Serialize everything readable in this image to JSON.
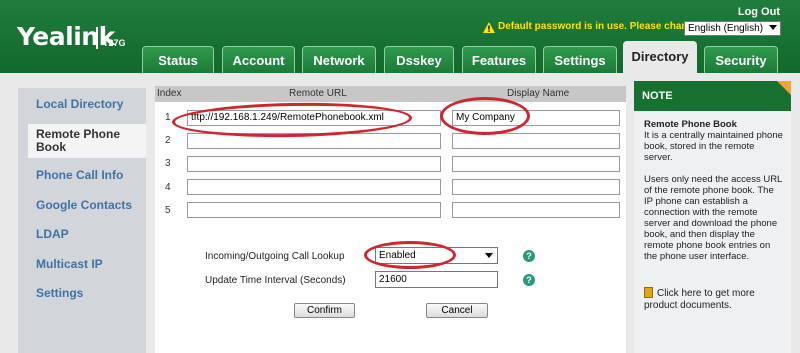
{
  "header": {
    "brand": "Yealink",
    "model": "T27G",
    "logout": "Log Out",
    "warning": "Default password is in use. Please change!",
    "language": "English (English)"
  },
  "tabs": [
    "Status",
    "Account",
    "Network",
    "Dsskey",
    "Features",
    "Settings",
    "Directory",
    "Security"
  ],
  "active_tab": "Directory",
  "sidebar": {
    "items": [
      "Local Directory",
      "Remote Phone Book",
      "Phone Call Info",
      "Google Contacts",
      "LDAP",
      "Multicast IP",
      "Settings"
    ],
    "active": "Remote Phone Book"
  },
  "table": {
    "headers": {
      "index": "Index",
      "url": "Remote URL",
      "name": "Display Name"
    },
    "rows": [
      {
        "index": "1",
        "url": "tftp://192.168.1.249/RemotePhonebook.xml",
        "name": "My Company"
      },
      {
        "index": "2",
        "url": "",
        "name": ""
      },
      {
        "index": "3",
        "url": "",
        "name": ""
      },
      {
        "index": "4",
        "url": "",
        "name": ""
      },
      {
        "index": "5",
        "url": "",
        "name": ""
      }
    ]
  },
  "form": {
    "lookup_label": "Incoming/Outgoing Call Lookup",
    "lookup_value": "Enabled",
    "interval_label": "Update Time Interval (Seconds)",
    "interval_value": "21600",
    "help": "?",
    "confirm": "Confirm",
    "cancel": "Cancel"
  },
  "note": {
    "heading": "NOTE",
    "title": "Remote Phone Book",
    "p1": "It is a centrally maintained phone book, stored in the remote server.",
    "p2": "Users only need the access URL of the remote phone book. The IP phone can establish a connection with the remote server and download the phone book, and then display the remote phone book entries on the phone user interface.",
    "link": "Click here to get more product documents."
  },
  "colors": {
    "header_green": "#1f7d3c",
    "annotation_red": "#d0242f",
    "warning_yellow": "#ffe500",
    "nav_blue": "#3f73a5"
  }
}
